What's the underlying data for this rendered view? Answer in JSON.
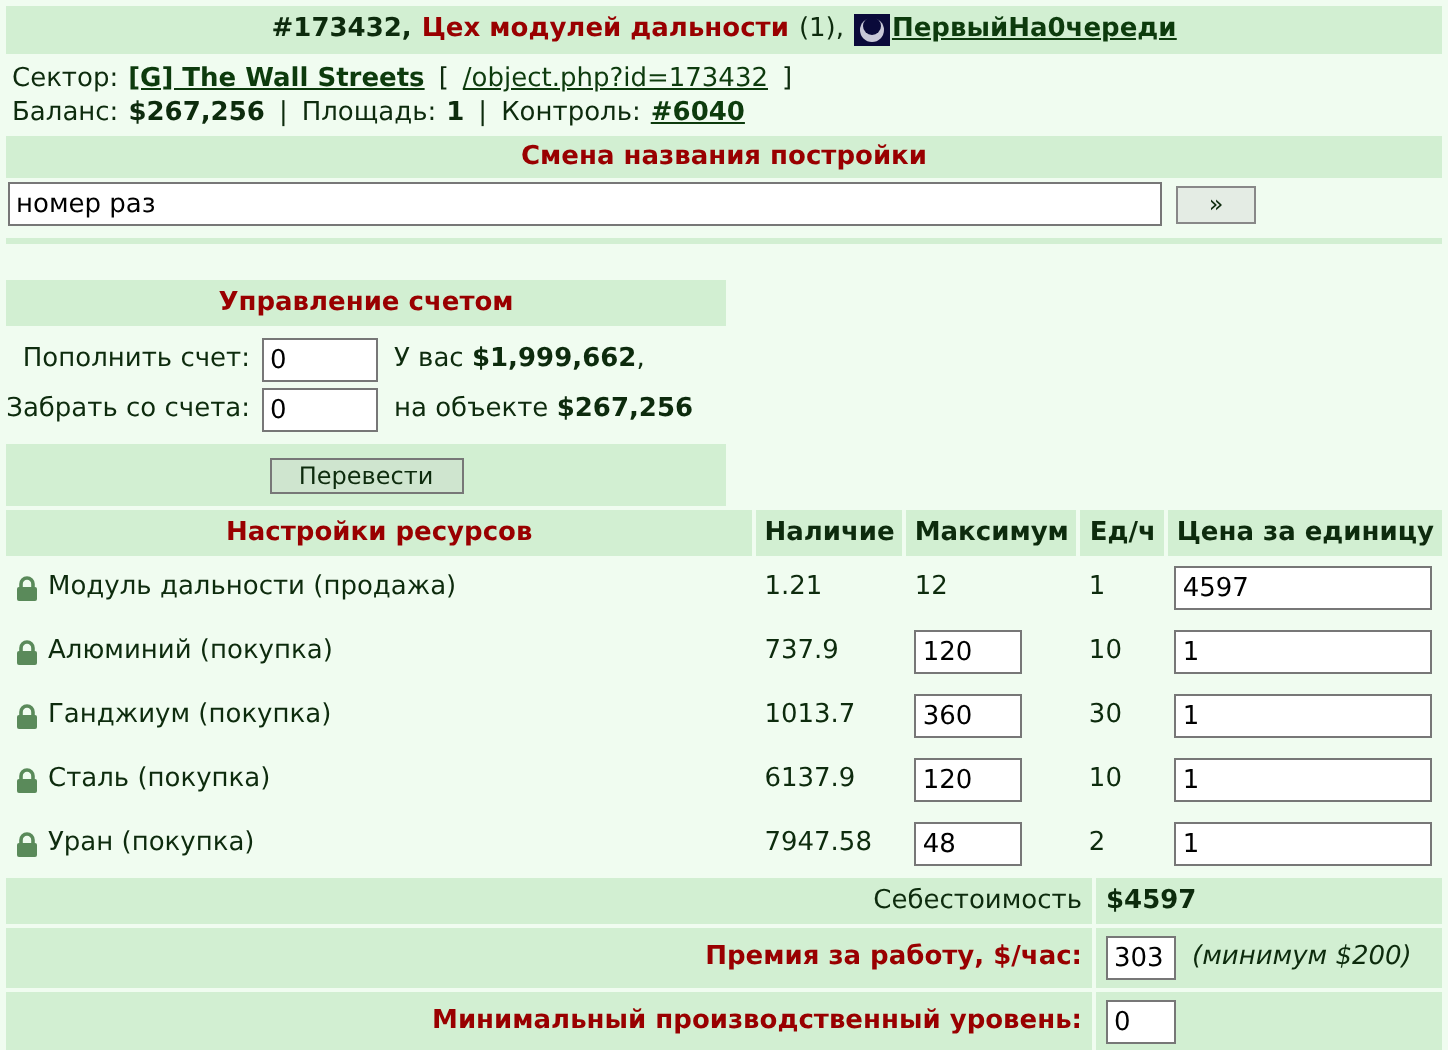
{
  "header": {
    "id": "#173432,",
    "name": "Цех модулей дальности",
    "count": "(1),",
    "owner": "ПервыйНа0череди"
  },
  "info": [
    [
      {
        "kind": "text",
        "text": "Сектор:"
      },
      {
        "kind": "link",
        "text": "[G] The Wall Streets"
      },
      {
        "kind": "plain",
        "text": "["
      },
      {
        "kind": "url",
        "text": "/object.php?id=173432"
      },
      {
        "kind": "plain",
        "text": "]"
      }
    ],
    [
      {
        "kind": "text",
        "text": "Баланс:"
      },
      {
        "kind": "bold",
        "text": "$267,256"
      },
      {
        "kind": "plain",
        "text": "|"
      },
      {
        "kind": "text",
        "text": "Площадь:"
      },
      {
        "kind": "bold",
        "text": "1"
      },
      {
        "kind": "plain",
        "text": "|"
      },
      {
        "kind": "text",
        "text": "Контроль:"
      },
      {
        "kind": "link",
        "text": "#6040"
      }
    ]
  ],
  "rename": {
    "title": "Смена названия постройки",
    "value": "номер раз",
    "button": "»"
  },
  "account": {
    "title": "Управление счетом",
    "rows": [
      {
        "label": "Пополнить счет:",
        "value": "0",
        "note": "У вас **$1,999,662**,"
      },
      {
        "label": "Забрать со счета:",
        "value": "0",
        "note": "на объекте **$267,256**"
      }
    ],
    "button": "Перевести"
  },
  "resources": {
    "columns": [
      "Настройки ресурсов",
      "Наличие",
      "Максимум",
      "Ед/ч",
      "Цена за единицу"
    ],
    "rows": [
      {
        "name": "Модуль дальности (продажа)",
        "locked": true,
        "stock": "1.21",
        "max": "12",
        "max_editable": false,
        "rate": "1",
        "price": "4597"
      },
      {
        "name": "Алюминий (покупка)",
        "locked": true,
        "stock": "737.9",
        "max": "120",
        "max_editable": true,
        "rate": "10",
        "price": "1"
      },
      {
        "name": "Ганджиум (покупка)",
        "locked": true,
        "stock": "1013.7",
        "max": "360",
        "max_editable": true,
        "rate": "30",
        "price": "1"
      },
      {
        "name": "Сталь (покупка)",
        "locked": true,
        "stock": "6137.9",
        "max": "120",
        "max_editable": true,
        "rate": "10",
        "price": "1"
      },
      {
        "name": "Уран (покупка)",
        "locked": true,
        "stock": "7947.58",
        "max": "48",
        "max_editable": true,
        "rate": "2",
        "price": "1"
      }
    ]
  },
  "cost": {
    "label": "Себестоимость",
    "value": "$4597"
  },
  "bonus": {
    "label": "Премия за работу, $/час:",
    "value": "303",
    "hint": "(минимум $200)"
  },
  "min_level": {
    "label": "Минимальный производственный уровень:",
    "value": "0"
  }
}
